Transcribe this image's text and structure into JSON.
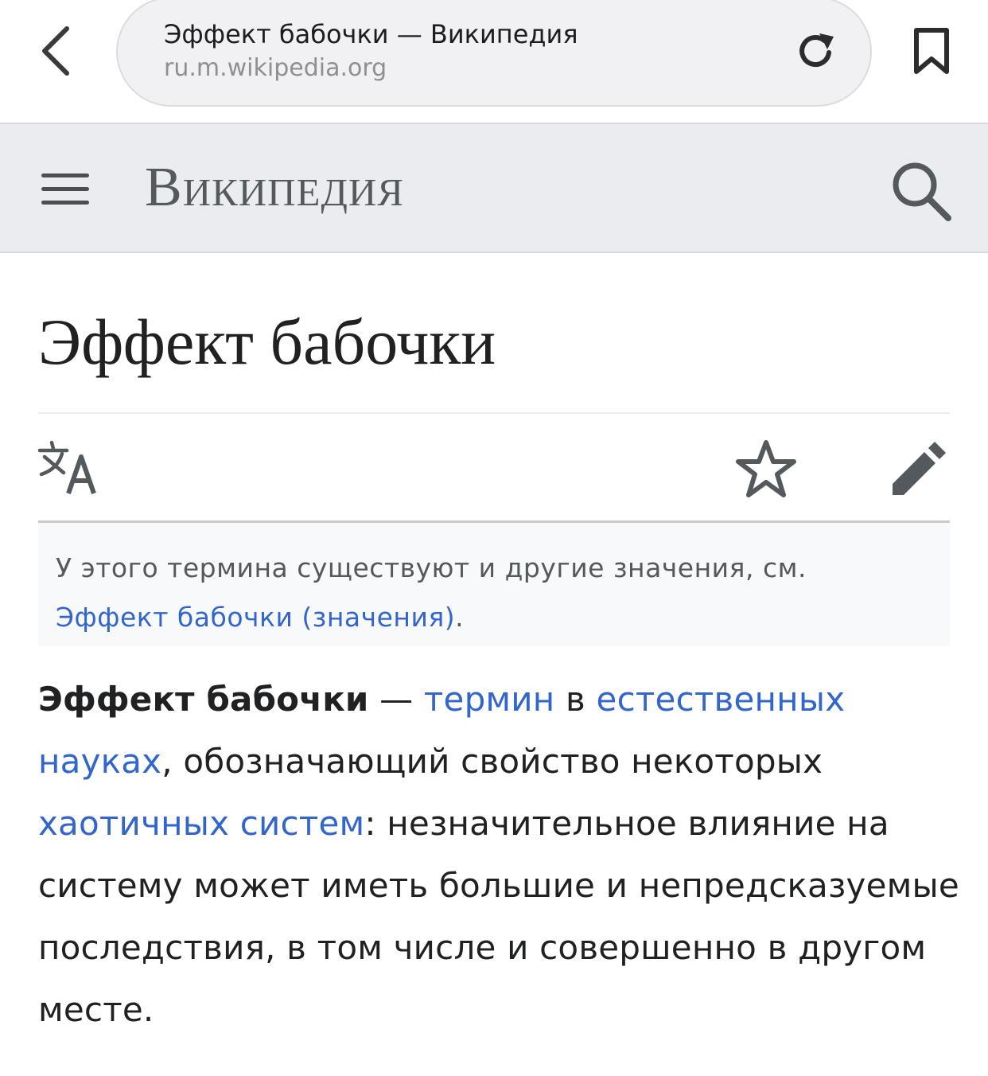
{
  "browser": {
    "page_title": "Эффект бабочки — Википедия",
    "host": "ru.m.wikipedia.org",
    "icons": {
      "back": "chevron-left-icon",
      "reload": "reload-icon",
      "bookmark": "bookmark-icon"
    }
  },
  "header": {
    "wordmark": "Википедия",
    "icons": {
      "menu": "hamburger-menu-icon",
      "search": "search-icon"
    }
  },
  "article": {
    "title": "Эффект бабочки",
    "page_actions": {
      "language": "language-icon",
      "watch": "star-icon",
      "edit": "pencil-icon"
    },
    "hatnote": {
      "text": "У этого термина существуют и другие значения, см.",
      "link": "Эффект бабочки (значения)",
      "end": "."
    },
    "lead": {
      "term": "Эффект бабочки",
      "dash": " — ",
      "link_term": "термин",
      "t_in": " в ",
      "link_sciences": "естественных науках",
      "t_mid": ", обозначающий свойство некоторых ",
      "link_chaos": "хаотичных систем",
      "t_rest": ": незначительное влияние на систему может иметь большие и непредсказуемые последствия, в том числе и совершенно в другом месте."
    }
  },
  "colors": {
    "link": "#3366cc",
    "header_bg": "#eaecf0",
    "text": "#202122",
    "secondary_text": "#54595d"
  }
}
